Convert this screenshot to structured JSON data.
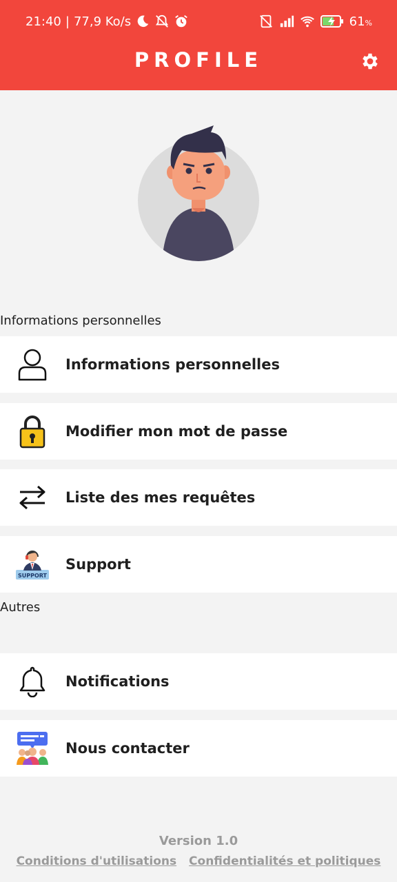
{
  "status_bar": {
    "time": "21:40",
    "separator": "|",
    "speed": "77,9 Ko/s",
    "battery_percent": "61",
    "battery_unit": "%",
    "icons_left": [
      "moon-icon",
      "bell-off-icon",
      "alarm-icon"
    ],
    "icons_right": [
      "no-sim-icon",
      "signal-icon",
      "wifi-icon",
      "battery-charging-icon"
    ]
  },
  "header": {
    "title": "PROFILE",
    "settings_icon": "gear-icon",
    "color": "#f2463c"
  },
  "sections": {
    "personal_heading": "Informations personnelles",
    "others_heading": "Autres"
  },
  "menu": {
    "personal": [
      {
        "label": "Informations personnelles",
        "icon": "user-icon"
      },
      {
        "label": "Modifier mon mot de passe",
        "icon": "padlock-icon"
      },
      {
        "label": "Liste des mes requêtes",
        "icon": "swap-arrows-icon"
      },
      {
        "label": "Support",
        "icon": "support-agent-icon",
        "icon_text": "SUPPORT"
      }
    ],
    "others": [
      {
        "label": "Notifications",
        "icon": "bell-icon"
      },
      {
        "label": "Nous contacter",
        "icon": "contact-group-icon"
      }
    ]
  },
  "footer": {
    "version": "Version 1.0",
    "terms_link": "Conditions d'utilisations",
    "privacy_link": "Confidentialités et politiques"
  }
}
